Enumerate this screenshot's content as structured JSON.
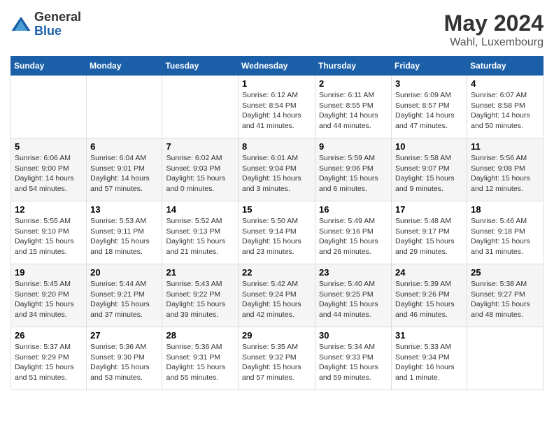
{
  "header": {
    "logo_general": "General",
    "logo_blue": "Blue",
    "month": "May 2024",
    "location": "Wahl, Luxembourg"
  },
  "weekdays": [
    "Sunday",
    "Monday",
    "Tuesday",
    "Wednesday",
    "Thursday",
    "Friday",
    "Saturday"
  ],
  "rows": [
    [
      {
        "day": "",
        "info": ""
      },
      {
        "day": "",
        "info": ""
      },
      {
        "day": "",
        "info": ""
      },
      {
        "day": "1",
        "info": "Sunrise: 6:12 AM\nSunset: 8:54 PM\nDaylight: 14 hours and 41 minutes."
      },
      {
        "day": "2",
        "info": "Sunrise: 6:11 AM\nSunset: 8:55 PM\nDaylight: 14 hours and 44 minutes."
      },
      {
        "day": "3",
        "info": "Sunrise: 6:09 AM\nSunset: 8:57 PM\nDaylight: 14 hours and 47 minutes."
      },
      {
        "day": "4",
        "info": "Sunrise: 6:07 AM\nSunset: 8:58 PM\nDaylight: 14 hours and 50 minutes."
      }
    ],
    [
      {
        "day": "5",
        "info": "Sunrise: 6:06 AM\nSunset: 9:00 PM\nDaylight: 14 hours and 54 minutes."
      },
      {
        "day": "6",
        "info": "Sunrise: 6:04 AM\nSunset: 9:01 PM\nDaylight: 14 hours and 57 minutes."
      },
      {
        "day": "7",
        "info": "Sunrise: 6:02 AM\nSunset: 9:03 PM\nDaylight: 15 hours and 0 minutes."
      },
      {
        "day": "8",
        "info": "Sunrise: 6:01 AM\nSunset: 9:04 PM\nDaylight: 15 hours and 3 minutes."
      },
      {
        "day": "9",
        "info": "Sunrise: 5:59 AM\nSunset: 9:06 PM\nDaylight: 15 hours and 6 minutes."
      },
      {
        "day": "10",
        "info": "Sunrise: 5:58 AM\nSunset: 9:07 PM\nDaylight: 15 hours and 9 minutes."
      },
      {
        "day": "11",
        "info": "Sunrise: 5:56 AM\nSunset: 9:08 PM\nDaylight: 15 hours and 12 minutes."
      }
    ],
    [
      {
        "day": "12",
        "info": "Sunrise: 5:55 AM\nSunset: 9:10 PM\nDaylight: 15 hours and 15 minutes."
      },
      {
        "day": "13",
        "info": "Sunrise: 5:53 AM\nSunset: 9:11 PM\nDaylight: 15 hours and 18 minutes."
      },
      {
        "day": "14",
        "info": "Sunrise: 5:52 AM\nSunset: 9:13 PM\nDaylight: 15 hours and 21 minutes."
      },
      {
        "day": "15",
        "info": "Sunrise: 5:50 AM\nSunset: 9:14 PM\nDaylight: 15 hours and 23 minutes."
      },
      {
        "day": "16",
        "info": "Sunrise: 5:49 AM\nSunset: 9:16 PM\nDaylight: 15 hours and 26 minutes."
      },
      {
        "day": "17",
        "info": "Sunrise: 5:48 AM\nSunset: 9:17 PM\nDaylight: 15 hours and 29 minutes."
      },
      {
        "day": "18",
        "info": "Sunrise: 5:46 AM\nSunset: 9:18 PM\nDaylight: 15 hours and 31 minutes."
      }
    ],
    [
      {
        "day": "19",
        "info": "Sunrise: 5:45 AM\nSunset: 9:20 PM\nDaylight: 15 hours and 34 minutes."
      },
      {
        "day": "20",
        "info": "Sunrise: 5:44 AM\nSunset: 9:21 PM\nDaylight: 15 hours and 37 minutes."
      },
      {
        "day": "21",
        "info": "Sunrise: 5:43 AM\nSunset: 9:22 PM\nDaylight: 15 hours and 39 minutes."
      },
      {
        "day": "22",
        "info": "Sunrise: 5:42 AM\nSunset: 9:24 PM\nDaylight: 15 hours and 42 minutes."
      },
      {
        "day": "23",
        "info": "Sunrise: 5:40 AM\nSunset: 9:25 PM\nDaylight: 15 hours and 44 minutes."
      },
      {
        "day": "24",
        "info": "Sunrise: 5:39 AM\nSunset: 9:26 PM\nDaylight: 15 hours and 46 minutes."
      },
      {
        "day": "25",
        "info": "Sunrise: 5:38 AM\nSunset: 9:27 PM\nDaylight: 15 hours and 48 minutes."
      }
    ],
    [
      {
        "day": "26",
        "info": "Sunrise: 5:37 AM\nSunset: 9:29 PM\nDaylight: 15 hours and 51 minutes."
      },
      {
        "day": "27",
        "info": "Sunrise: 5:36 AM\nSunset: 9:30 PM\nDaylight: 15 hours and 53 minutes."
      },
      {
        "day": "28",
        "info": "Sunrise: 5:36 AM\nSunset: 9:31 PM\nDaylight: 15 hours and 55 minutes."
      },
      {
        "day": "29",
        "info": "Sunrise: 5:35 AM\nSunset: 9:32 PM\nDaylight: 15 hours and 57 minutes."
      },
      {
        "day": "30",
        "info": "Sunrise: 5:34 AM\nSunset: 9:33 PM\nDaylight: 15 hours and 59 minutes."
      },
      {
        "day": "31",
        "info": "Sunrise: 5:33 AM\nSunset: 9:34 PM\nDaylight: 16 hours and 1 minute."
      },
      {
        "day": "",
        "info": ""
      }
    ]
  ]
}
